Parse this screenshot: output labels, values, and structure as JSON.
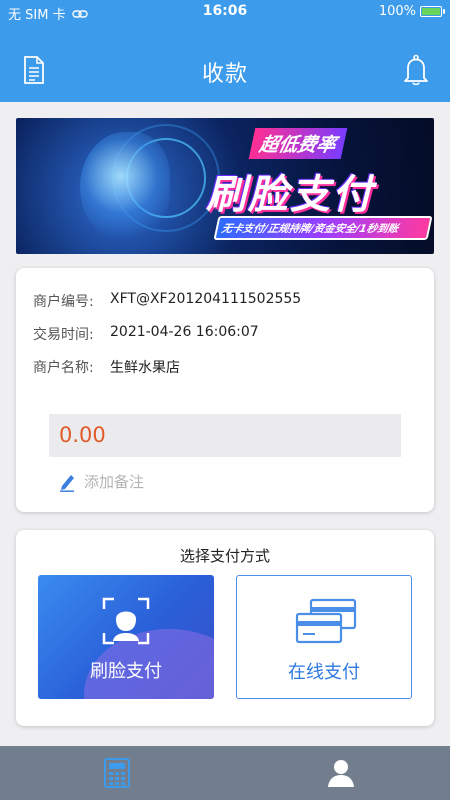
{
  "status_bar": {
    "carrier": "无 SIM 卡",
    "time": "16:06",
    "battery": "100%"
  },
  "header": {
    "title": "收款",
    "left_icon": "document-icon",
    "right_icon": "bell-icon"
  },
  "banner": {
    "tag": "超低费率",
    "main": "刷脸支付",
    "sub": "无卡支付/正规持牌/资金安全/1秒到账"
  },
  "merchant": {
    "id_label": "商户编号:",
    "id_value": "XFT@XF201204111502555",
    "time_label": "交易时间:",
    "time_value": "2021-04-26 16:06:07",
    "name_label": "商户名称:",
    "name_value": "生鲜水果店"
  },
  "amount": {
    "value": "0.00"
  },
  "remark": {
    "placeholder": "添加备注"
  },
  "payment": {
    "title": "选择支付方式",
    "face_label": "刷脸支付",
    "online_label": "在线支付"
  },
  "bottom_nav": {
    "items": [
      {
        "icon": "calculator-icon",
        "active": true
      },
      {
        "icon": "person-icon",
        "active": false
      }
    ]
  },
  "colors": {
    "primary": "#3c9bea",
    "amount": "#e05a2a",
    "nav_bg": "#727d8d",
    "nav_active": "#3c9bea"
  }
}
